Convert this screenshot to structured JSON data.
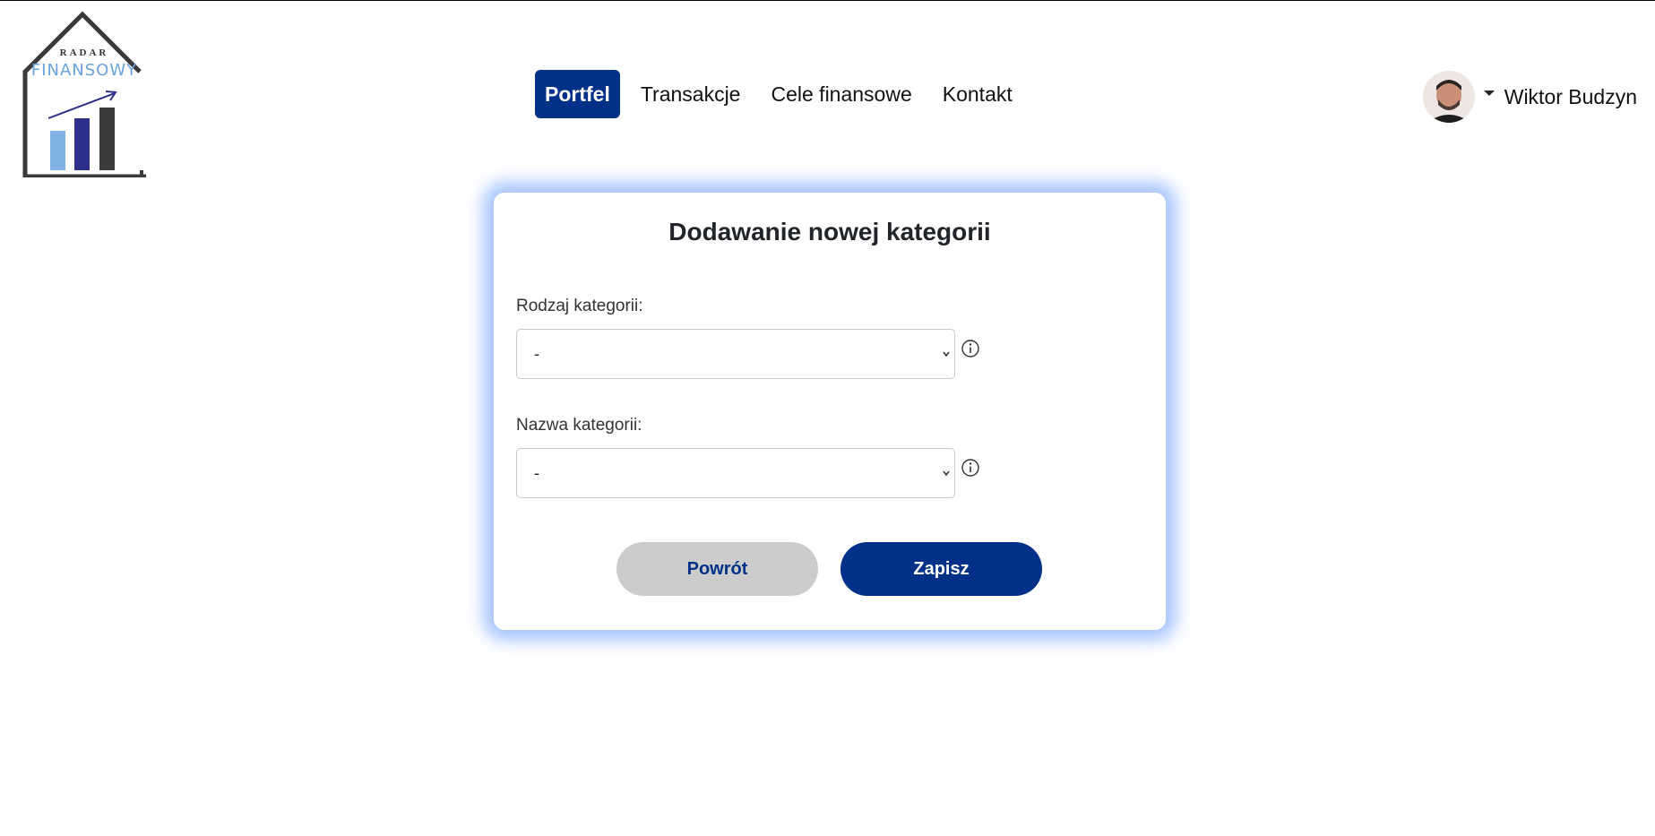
{
  "logo": {
    "top_text": "RADAR",
    "main_text": "FINANSOWY",
    "colors": {
      "house": "#3a3a3a",
      "bar1": "#7fb1e3",
      "bar2": "#2e2f8a",
      "bar3": "#3a3a3a",
      "arrow": "#2e2f8a"
    }
  },
  "nav": {
    "items": [
      {
        "label": "Portfel",
        "active": true
      },
      {
        "label": "Transakcje",
        "active": false
      },
      {
        "label": "Cele finansowe",
        "active": false
      },
      {
        "label": "Kontakt",
        "active": false
      }
    ]
  },
  "user": {
    "name": "Wiktor Budzyn",
    "menu_icon": "caret-down-icon"
  },
  "form": {
    "title": "Dodawanie nowej kategorii",
    "fields": [
      {
        "label": "Rodzaj kategorii:",
        "value": "-",
        "icon": "info-icon"
      },
      {
        "label": "Nazwa kategorii:",
        "value": "-",
        "icon": "info-icon"
      }
    ],
    "buttons": {
      "back": "Powrót",
      "save": "Zapisz"
    }
  },
  "theme": {
    "primary": "#003087",
    "secondary_button": "#cccccc",
    "card_glow": "#6096ff"
  }
}
